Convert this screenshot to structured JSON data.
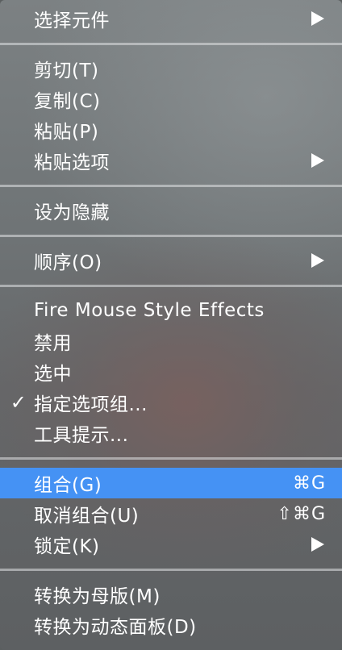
{
  "menu": {
    "groups": [
      {
        "items": [
          {
            "label": "选择元件",
            "submenu": true
          }
        ]
      },
      {
        "items": [
          {
            "label": "剪切(T)"
          },
          {
            "label": "复制(C)"
          },
          {
            "label": "粘贴(P)"
          },
          {
            "label": "粘贴选项",
            "submenu": true
          }
        ]
      },
      {
        "items": [
          {
            "label": "设为隐藏"
          }
        ]
      },
      {
        "items": [
          {
            "label": "顺序(O)",
            "submenu": true
          }
        ]
      },
      {
        "items": [
          {
            "label": "Fire Mouse Style Effects"
          },
          {
            "label": "禁用"
          },
          {
            "label": "选中"
          },
          {
            "label": "指定选项组...",
            "checked": true,
            "check_glyph": "✓"
          },
          {
            "label": "工具提示..."
          }
        ]
      },
      {
        "items": [
          {
            "label": "组合(G)",
            "shortcut": "⌘G",
            "highlighted": true
          },
          {
            "label": "取消组合(U)",
            "shortcut": "⇧⌘G"
          },
          {
            "label": "锁定(K)",
            "submenu": true
          }
        ]
      },
      {
        "items": [
          {
            "label": "转换为母版(M)"
          },
          {
            "label": "转换为动态面板(D)"
          }
        ]
      }
    ]
  },
  "colors": {
    "highlight": "#4592f4",
    "text": "#ffffff"
  },
  "icons": {
    "submenu": "submenu-arrow-icon",
    "check": "checkmark-icon"
  }
}
